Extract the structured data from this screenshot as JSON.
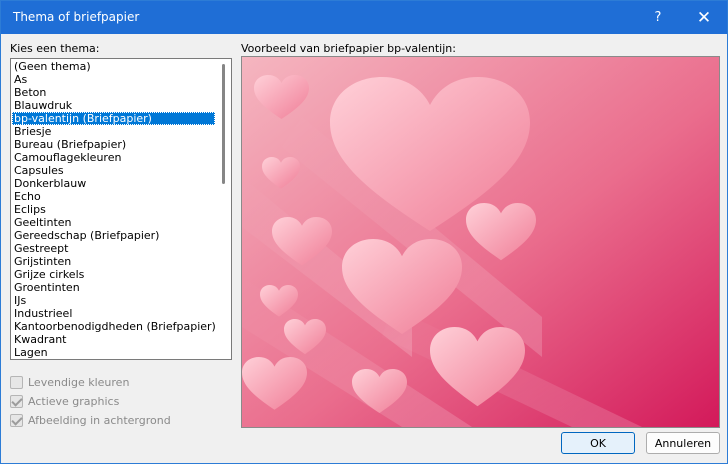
{
  "window": {
    "title": "Thema of briefpapier",
    "help_glyph": "?",
    "close_glyph": "✕"
  },
  "labels": {
    "choose_theme": "Kies een thema:",
    "preview": "Voorbeeld van briefpapier bp-valentijn:"
  },
  "themes": [
    "(Geen thema)",
    "As",
    "Beton",
    "Blauwdruk",
    "bp-valentijn (Briefpapier)",
    "Briesje",
    "Bureau (Briefpapier)",
    "Camouflagekleuren",
    "Capsules",
    "Donkerblauw",
    "Echo",
    "Eclips",
    "Geeltinten",
    "Gereedschap (Briefpapier)",
    "Gestreept",
    "Grijstinten",
    "Grijze cirkels",
    "Groentinten",
    "IJs",
    "Industrieel",
    "Kantoorbenodigdheden (Briefpapier)",
    "Kwadrant",
    "Lagen"
  ],
  "selected_theme_index": 4,
  "options": {
    "vivid_colors": {
      "label": "Levendige kleuren",
      "checked": false
    },
    "active_graphics": {
      "label": "Actieve graphics",
      "checked": true
    },
    "background_image": {
      "label": "Afbeelding in achtergrond",
      "checked": true
    }
  },
  "buttons": {
    "ok": "OK",
    "cancel": "Annuleren"
  },
  "colors": {
    "title_bar": "#1f6ed6",
    "selection": "#0078d7",
    "preview_bg_start": "#f3a6b3",
    "preview_bg_end": "#d81b5c"
  }
}
